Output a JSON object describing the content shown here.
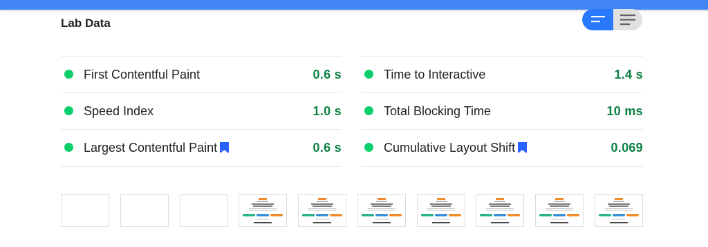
{
  "section": {
    "title": "Lab Data"
  },
  "view_toggle": {
    "options": [
      "list-view-icon",
      "detailed-view-icon"
    ],
    "selected": "list-view-icon",
    "accent_color": "#2979ff"
  },
  "metrics": {
    "left": [
      {
        "label": "First Contentful Paint",
        "value": "0.6 s",
        "status_color": "#0cce6b",
        "bookmark": false
      },
      {
        "label": "Speed Index",
        "value": "1.0 s",
        "status_color": "#0cce6b",
        "bookmark": false
      },
      {
        "label": "Largest Contentful Paint",
        "value": "0.6 s",
        "status_color": "#0cce6b",
        "bookmark": true
      }
    ],
    "right": [
      {
        "label": "Time to Interactive",
        "value": "1.4 s",
        "status_color": "#0cce6b",
        "bookmark": false
      },
      {
        "label": "Total Blocking Time",
        "value": "10 ms",
        "status_color": "#0cce6b",
        "bookmark": false
      },
      {
        "label": "Cumulative Layout Shift",
        "value": "0.069",
        "status_color": "#0cce6b",
        "bookmark": true
      }
    ]
  },
  "filmstrip": {
    "frames": [
      {
        "state": "blank"
      },
      {
        "state": "blank"
      },
      {
        "state": "blank"
      },
      {
        "state": "rendered"
      },
      {
        "state": "rendered"
      },
      {
        "state": "rendered"
      },
      {
        "state": "rendered"
      },
      {
        "state": "rendered"
      },
      {
        "state": "rendered"
      },
      {
        "state": "rendered"
      }
    ]
  },
  "colors": {
    "topbar": "#4285f4",
    "pass_green": "#0cce6b",
    "value_green": "#0b8043",
    "bookmark_blue": "#2962ff"
  }
}
